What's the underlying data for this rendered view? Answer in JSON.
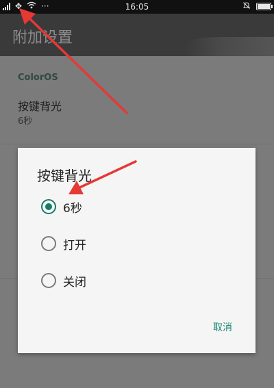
{
  "status_bar": {
    "time": "16:05",
    "left_icons": [
      "signal-icon",
      "sync-icon",
      "wifi-icon",
      "more-icon"
    ],
    "right_icons": [
      "bell-off-icon",
      "battery-icon"
    ],
    "more_glyph": "···",
    "battery_level": 1.0
  },
  "app_bar": {
    "title": "附加设置"
  },
  "settings": {
    "section_header": "ColorOS",
    "item_title": "按键背光",
    "item_value": "6秒"
  },
  "dialog": {
    "title": "按键背光",
    "options": [
      {
        "label": "6秒",
        "selected": true
      },
      {
        "label": "打开",
        "selected": false
      },
      {
        "label": "关闭",
        "selected": false
      }
    ],
    "cancel_label": "取消"
  },
  "colors": {
    "accent": "#187a6a",
    "annotation_arrow": "#e53935"
  }
}
